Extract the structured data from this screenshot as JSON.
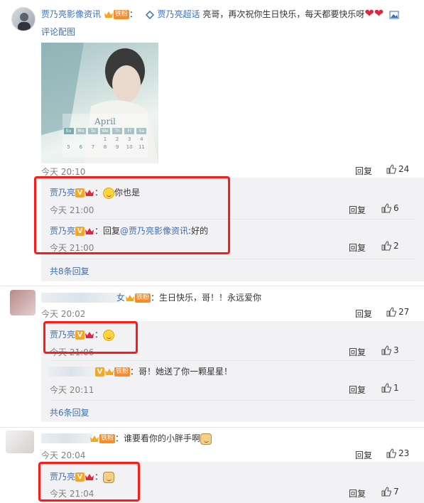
{
  "main_comment": {
    "user": "贾乃亮影像资讯",
    "badge": "铁粉",
    "colon": "：",
    "topic": "贾乃亮超话",
    "text": "亮哥，再次祝你生日快乐，每天都要快乐呀",
    "pic_link": "评论配图",
    "time": "今天 20:10",
    "reply_label": "回复",
    "likes": "24"
  },
  "image": {
    "month_label": "April",
    "weekdays": [
      "Su",
      "Mo",
      "Tu",
      "We",
      "Th",
      "Fr",
      "Sa"
    ],
    "row1": [
      "",
      "",
      "",
      "1",
      "2",
      "3",
      "4"
    ],
    "row2": [
      "5",
      "6",
      "7",
      "8",
      "9",
      "10",
      "11"
    ]
  },
  "thread1": {
    "r1": {
      "user": "贾乃亮",
      "text": "你也是",
      "time": "今天 21:00",
      "reply_label": "回复",
      "likes": "6"
    },
    "r2": {
      "user": "贾乃亮",
      "prefix": "：回复",
      "mention": "@贾乃亮影像资讯",
      "text": ":好的",
      "time": "今天 21:00",
      "reply_label": "回复",
      "likes": "2"
    },
    "more": "共8条回复"
  },
  "comment2": {
    "user_suffix": "女",
    "badge": "铁粉",
    "text": "：生日快乐，哥！！永远爱你",
    "time": "今天 20:02",
    "reply_label": "回复",
    "likes": "27"
  },
  "thread2": {
    "r1": {
      "user": "贾乃亮",
      "colon": "：",
      "time": "今天 21:06",
      "reply_label": "回复",
      "likes": "3"
    },
    "r2": {
      "badge": "铁粉",
      "text": "：哥！她送了你一颗星星！",
      "time": "今天 20:11",
      "reply_label": "回复",
      "likes": "1"
    },
    "more": "共6条回复"
  },
  "comment3": {
    "badge": "铁粉",
    "text": "：谁要看你的小胖手啊",
    "time": "今天 20:04",
    "reply_label": "回复",
    "likes": "23"
  },
  "thread3": {
    "r1": {
      "user": "贾乃亮",
      "colon": "：",
      "time": "今天 21:04",
      "reply_label": "回复",
      "likes": "7"
    }
  },
  "colors": {
    "link": "#eb7350",
    "name": "#3b6fb6",
    "highlight": "#ff1a1a"
  }
}
